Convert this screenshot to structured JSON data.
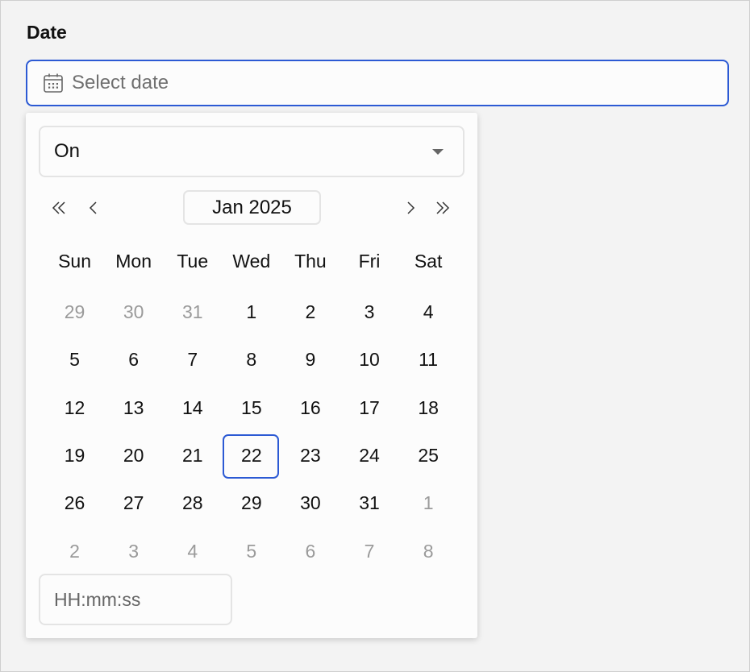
{
  "field": {
    "label": "Date",
    "placeholder": "Select date",
    "icon": "calendar-icon",
    "accent_color": "#2c5ad4"
  },
  "popup": {
    "mode": {
      "selected": "On",
      "icon": "caret-down-icon"
    },
    "navigation": {
      "prev_year_icon": "double-chevron-left-icon",
      "prev_month_icon": "chevron-left-icon",
      "month_label": "Jan 2025",
      "next_month_icon": "chevron-right-icon",
      "next_year_icon": "double-chevron-right-icon",
      "prev_year_glyph": "«",
      "prev_month_glyph": "‹",
      "next_month_glyph": "›",
      "next_year_glyph": "»"
    },
    "weekdays": [
      "Sun",
      "Mon",
      "Tue",
      "Wed",
      "Thu",
      "Fri",
      "Sat"
    ],
    "weeks": [
      [
        {
          "d": "29",
          "muted": true
        },
        {
          "d": "30",
          "muted": true
        },
        {
          "d": "31",
          "muted": true
        },
        {
          "d": "1"
        },
        {
          "d": "2"
        },
        {
          "d": "3"
        },
        {
          "d": "4"
        }
      ],
      [
        {
          "d": "5"
        },
        {
          "d": "6"
        },
        {
          "d": "7"
        },
        {
          "d": "8"
        },
        {
          "d": "9"
        },
        {
          "d": "10"
        },
        {
          "d": "11"
        }
      ],
      [
        {
          "d": "12"
        },
        {
          "d": "13"
        },
        {
          "d": "14"
        },
        {
          "d": "15"
        },
        {
          "d": "16"
        },
        {
          "d": "17"
        },
        {
          "d": "18"
        }
      ],
      [
        {
          "d": "19"
        },
        {
          "d": "20"
        },
        {
          "d": "21"
        },
        {
          "d": "22",
          "today": true
        },
        {
          "d": "23"
        },
        {
          "d": "24"
        },
        {
          "d": "25"
        }
      ],
      [
        {
          "d": "26"
        },
        {
          "d": "27"
        },
        {
          "d": "28"
        },
        {
          "d": "29"
        },
        {
          "d": "30"
        },
        {
          "d": "31"
        },
        {
          "d": "1",
          "muted": true
        }
      ],
      [
        {
          "d": "2",
          "muted": true
        },
        {
          "d": "3",
          "muted": true
        },
        {
          "d": "4",
          "muted": true
        },
        {
          "d": "5",
          "muted": true
        },
        {
          "d": "6",
          "muted": true
        },
        {
          "d": "7",
          "muted": true
        },
        {
          "d": "8",
          "muted": true
        }
      ]
    ],
    "time": {
      "placeholder": "HH:mm:ss"
    }
  }
}
